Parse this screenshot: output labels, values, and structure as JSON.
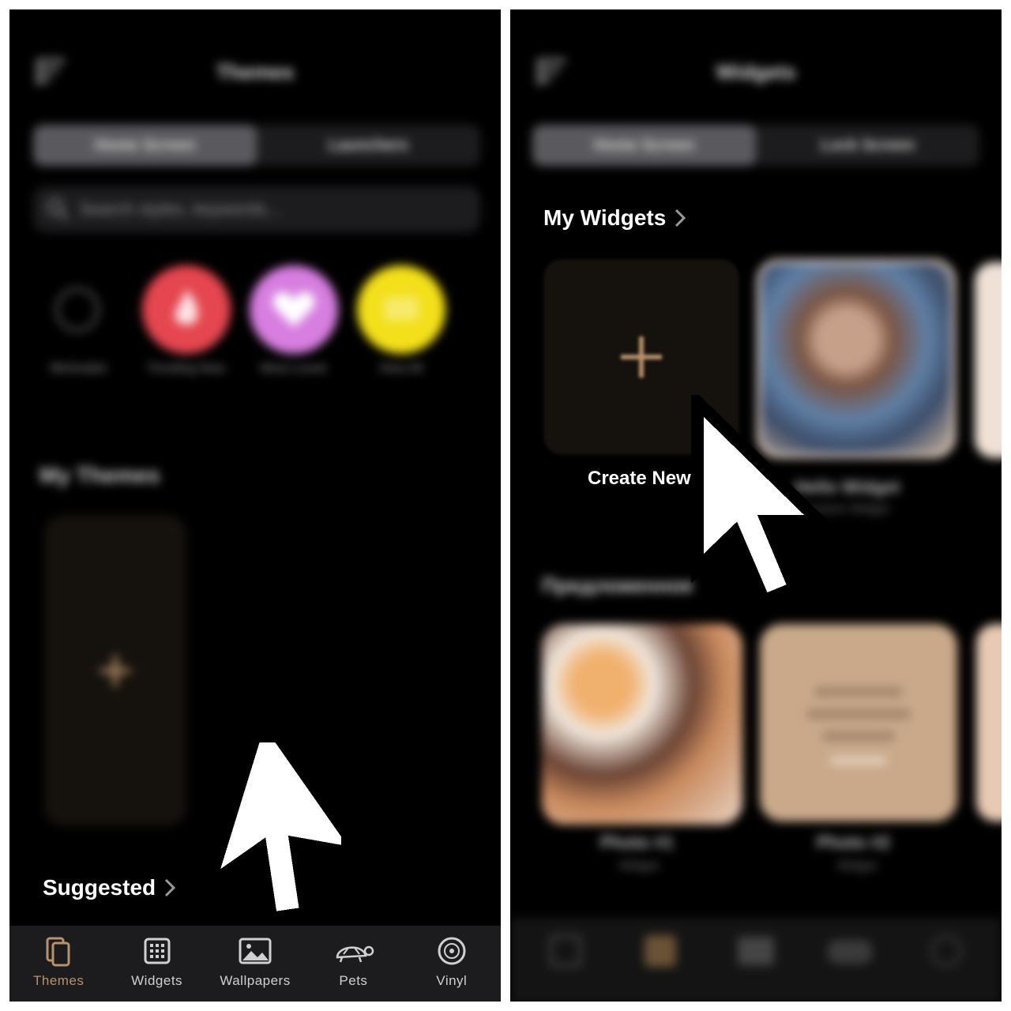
{
  "left": {
    "title": "Themes",
    "segments": [
      "Home Screen",
      "Launchers"
    ],
    "search_placeholder": "Search styles, keywords...",
    "categories": [
      {
        "label": "Minimalist",
        "color": "#1a1a1a",
        "icon": "ring-icon"
      },
      {
        "label": "Trending Now",
        "color": "#e5464f",
        "icon": "fire-icon"
      },
      {
        "label": "Most Loved",
        "color": "#d77ee0",
        "icon": "heart-icon"
      },
      {
        "label": "View All",
        "color": "#f3df1a",
        "icon": "square-icon"
      }
    ],
    "my_themes_title": "My Themes",
    "suggested_title": "Suggested",
    "tabs": [
      {
        "label": "Themes",
        "icon": "themes-icon",
        "active": true
      },
      {
        "label": "Widgets",
        "icon": "widgets-icon",
        "active": false
      },
      {
        "label": "Wallpapers",
        "icon": "wallpapers-icon",
        "active": false
      },
      {
        "label": "Pets",
        "icon": "turtle-icon",
        "active": false
      },
      {
        "label": "Vinyl",
        "icon": "vinyl-icon",
        "active": false
      }
    ]
  },
  "right": {
    "title": "Widgets",
    "segments": [
      "Home Screen",
      "Lock Screen"
    ],
    "my_widgets_title": "My Widgets",
    "create_new_label": "Create New",
    "widget_name": "Hello Widget",
    "widget_sub": "Custom Widget",
    "suggested_title": "Предложенное",
    "suggested_items": [
      {
        "name": "Photo #1",
        "sub": "Widget"
      },
      {
        "name": "Photo #2",
        "sub": "Widget"
      }
    ]
  },
  "colors": {
    "accent": "#b8926a",
    "background": "#000000",
    "tabbar": "#1c1c1e"
  }
}
